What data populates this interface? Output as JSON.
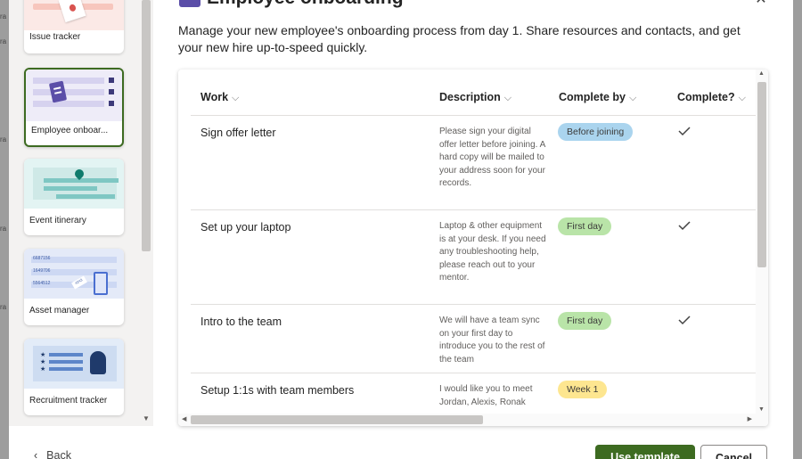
{
  "background_fragments": [
    "ra",
    "ra",
    "ra",
    "ra",
    "ra"
  ],
  "dialog": {
    "title": "Employee onboarding",
    "description": "Manage your new employee's onboarding process from day 1. Share resources and contacts, and get your new hire up-to-speed quickly."
  },
  "templates": [
    {
      "label": "Issue tracker",
      "selected": false
    },
    {
      "label": "Employee onboar...",
      "selected": true
    },
    {
      "label": "Event itinerary",
      "selected": false
    },
    {
      "label": "Asset manager",
      "selected": false
    },
    {
      "label": "Recruitment tracker",
      "selected": false
    }
  ],
  "asset_thumb_text": [
    "6687156",
    "1649706",
    "5564512",
    "4243"
  ],
  "table": {
    "columns": [
      "Work",
      "Description",
      "Complete by",
      "Complete?"
    ],
    "rows": [
      {
        "work": "Sign offer letter",
        "description": "Please sign your digital offer letter before joining. A hard copy will be mailed to your address soon for your records.",
        "complete_by": "Before joining",
        "pill_color": "#aad4ee",
        "complete": true
      },
      {
        "work": "Set up your laptop",
        "description": "Laptop & other equipment is at your desk. If you need any troubleshooting help, please reach out to your mentor.",
        "complete_by": "First day",
        "pill_color": "#b9e4a8",
        "complete": true
      },
      {
        "work": "Intro to the team",
        "description": "We will have a team sync on your first day to introduce you to the rest of the team",
        "complete_by": "First day",
        "pill_color": "#b9e4a8",
        "complete": true
      },
      {
        "work": "Setup 1:1s with team members",
        "description": "I would like you to meet Jordan, Alexis, Ronak",
        "complete_by": "Week 1",
        "pill_color": "#fde690",
        "complete": false
      }
    ]
  },
  "footer": {
    "back_label": "Back",
    "primary_label": "Use template",
    "secondary_label": "Cancel"
  },
  "colors": {
    "accent": "#3d6b21",
    "title_icon": "#5b4ea8"
  }
}
